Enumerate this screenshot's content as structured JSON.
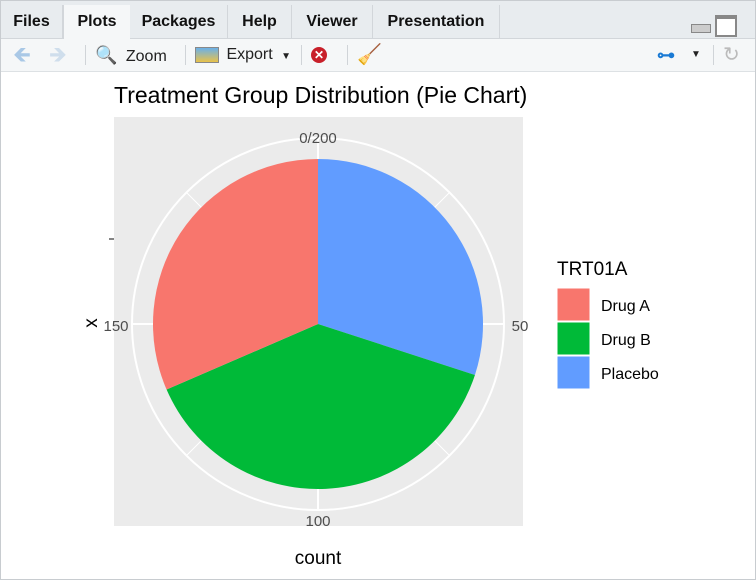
{
  "tabs": [
    {
      "label": "Files"
    },
    {
      "label": "Plots",
      "active": true
    },
    {
      "label": "Packages"
    },
    {
      "label": "Help"
    },
    {
      "label": "Viewer"
    },
    {
      "label": "Presentation"
    }
  ],
  "toolbar": {
    "zoom_label": "Zoom",
    "export_label": "Export"
  },
  "chart_data": {
    "type": "pie",
    "title": "Treatment Group Distribution (Pie Chart)",
    "xlabel": "count",
    "ylabel": "x",
    "theta_ticks": [
      {
        "value": 0,
        "label": "0/200"
      },
      {
        "value": 50,
        "label": "50"
      },
      {
        "value": 100,
        "label": "100"
      },
      {
        "value": 150,
        "label": "150"
      }
    ],
    "total": 200,
    "legend": {
      "title": "TRT01A",
      "position": "right"
    },
    "slices": [
      {
        "name": "Drug A",
        "value": 63,
        "color": "#F8766D"
      },
      {
        "name": "Drug B",
        "value": 77,
        "color": "#00BA38"
      },
      {
        "name": "Placebo",
        "value": 60,
        "color": "#619CFF"
      }
    ],
    "panel_background": "#EBEBEB"
  }
}
